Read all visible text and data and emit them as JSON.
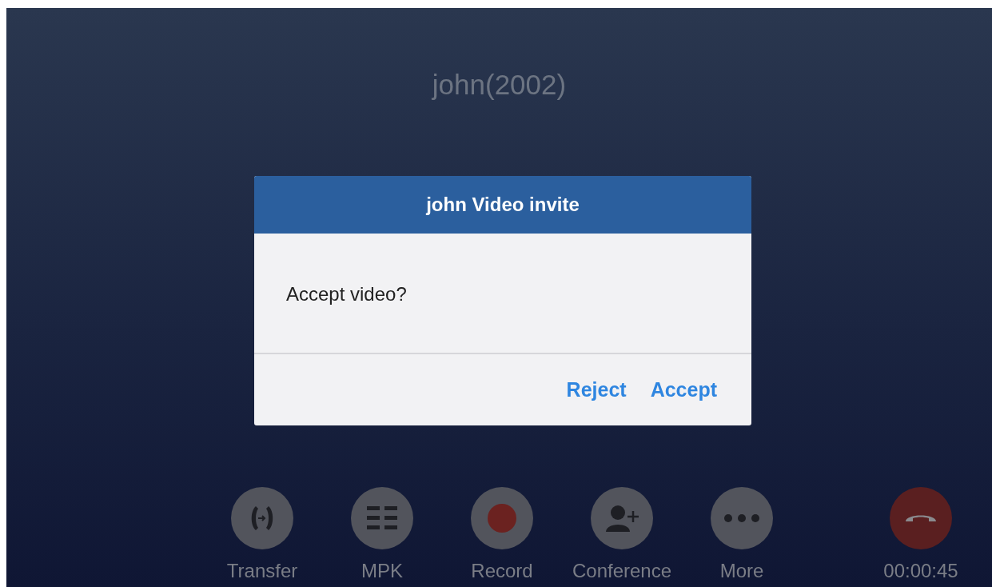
{
  "caller": {
    "name": "john(2002)"
  },
  "dialog": {
    "title": "john Video invite",
    "message": "Accept video?",
    "buttons": [
      {
        "label": "Reject"
      },
      {
        "label": "Accept"
      }
    ]
  },
  "actions": [
    {
      "kind": "transfer",
      "label": "Transfer"
    },
    {
      "kind": "mpk",
      "label": "MPK"
    },
    {
      "kind": "record",
      "label": "Record"
    },
    {
      "kind": "conference",
      "label": "Conference"
    },
    {
      "kind": "more",
      "label": "More"
    }
  ],
  "hangup": {
    "timer": "00:00:45"
  }
}
